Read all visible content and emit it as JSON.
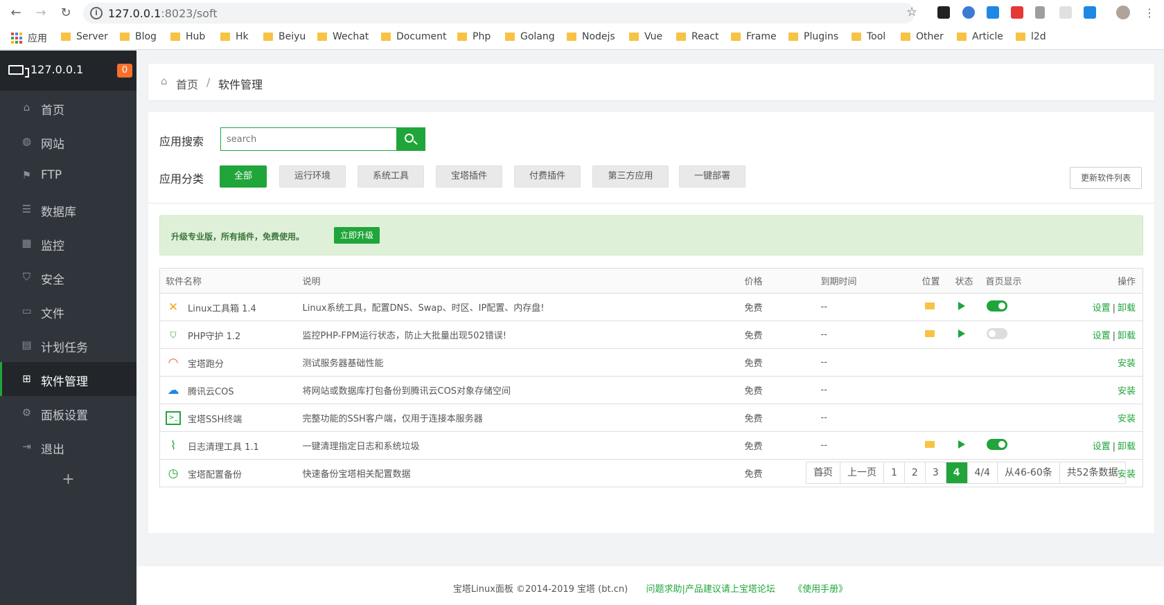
{
  "browser": {
    "url_host": "127.0.0.1",
    "url_rest": ":8023/soft",
    "bookmarks": [
      "应用",
      "Server",
      "Blog",
      "Hub",
      "Hk",
      "Beiyu",
      "Wechat",
      "Document",
      "Php",
      "Golang",
      "Nodejs",
      "Vue",
      "React",
      "Frame",
      "Plugins",
      "Tool",
      "Other",
      "Article",
      "l2d"
    ]
  },
  "sidebar": {
    "host": "127.0.0.1",
    "badge": "0",
    "items": [
      {
        "label": "首页",
        "icon": "home-icon"
      },
      {
        "label": "网站",
        "icon": "globe-icon"
      },
      {
        "label": "FTP",
        "icon": "ftp-icon"
      },
      {
        "label": "数据库",
        "icon": "database-icon"
      },
      {
        "label": "监控",
        "icon": "monitor-icon"
      },
      {
        "label": "安全",
        "icon": "shield-icon"
      },
      {
        "label": "文件",
        "icon": "folder-icon"
      },
      {
        "label": "计划任务",
        "icon": "calendar-icon"
      },
      {
        "label": "软件管理",
        "icon": "grid-icon"
      },
      {
        "label": "面板设置",
        "icon": "gear-icon"
      },
      {
        "label": "退出",
        "icon": "logout-icon"
      }
    ],
    "add": "+"
  },
  "breadcrumb": {
    "home": "首页",
    "sep": "/",
    "current": "软件管理"
  },
  "search": {
    "label": "应用搜索",
    "placeholder": "search"
  },
  "categories": {
    "label": "应用分类",
    "items": [
      "全部",
      "运行环境",
      "系统工具",
      "宝塔插件",
      "付费插件",
      "第三方应用",
      "一键部署"
    ],
    "update": "更新软件列表"
  },
  "notice": {
    "text": "升级专业版，所有插件，免费使用。",
    "button": "立即升级"
  },
  "table": {
    "headers": [
      "软件名称",
      "说明",
      "价格",
      "到期时间",
      "位置",
      "状态",
      "首页显示",
      "操作"
    ],
    "rows": [
      {
        "name": "Linux工具箱 1.4",
        "desc": "Linux系统工具，配置DNS、Swap、时区、IP配置、内存盘!",
        "price": "免费",
        "date": "--",
        "ops1": "设置",
        "ops2": "卸载"
      },
      {
        "name": "PHP守护 1.2",
        "desc": "监控PHP-FPM运行状态，防止大批量出现502错误!",
        "price": "免费",
        "date": "--",
        "ops1": "设置",
        "ops2": "卸载"
      },
      {
        "name": "宝塔跑分",
        "desc": "测试服务器基础性能",
        "price": "免费",
        "date": "--",
        "ops1": "安装"
      },
      {
        "name": "腾讯云COS",
        "desc": "将网站或数据库打包备份到腾讯云COS对象存储空间",
        "price": "免费",
        "date": "--",
        "ops1": "安装"
      },
      {
        "name": "宝塔SSH终端",
        "desc": "完整功能的SSH客户端，仅用于连接本服务器",
        "price": "免费",
        "date": "--",
        "ops1": "安装"
      },
      {
        "name": "日志清理工具 1.1",
        "desc": "一键清理指定日志和系统垃圾",
        "price": "免费",
        "date": "--",
        "ops1": "设置",
        "ops2": "卸载"
      },
      {
        "name": "宝塔配置备份",
        "desc": "快速备份宝塔相关配置数据",
        "price": "免费",
        "date": "--",
        "ops1": "安装"
      }
    ]
  },
  "pager": {
    "first": "首页",
    "prev": "上一页",
    "pages": [
      "1",
      "2",
      "3",
      "4"
    ],
    "current": "4",
    "total_pages": "4/4",
    "range": "从46-60条",
    "total": "共52条数据"
  },
  "footer": {
    "copy": "宝塔Linux面板 ©2014-2019 宝塔 (bt.cn)",
    "forum": "问题求助|产品建议请上宝塔论坛",
    "manual": "《使用手册》"
  }
}
